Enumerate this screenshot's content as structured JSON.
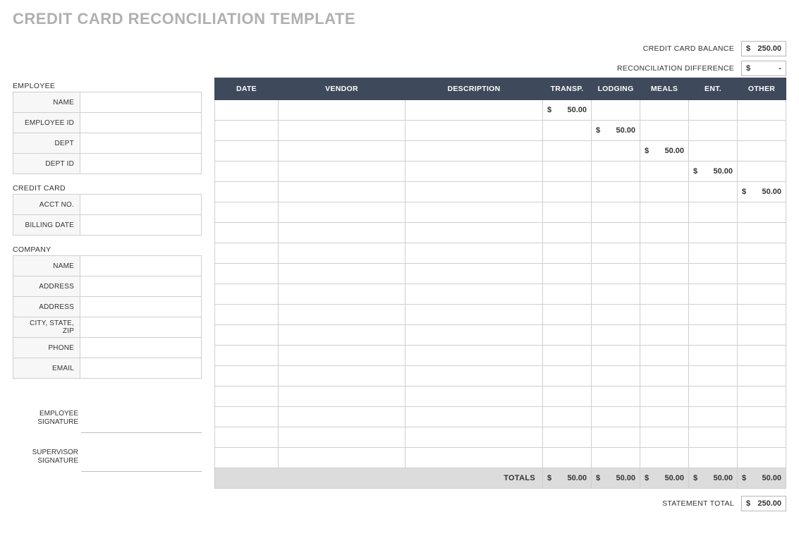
{
  "title": "CREDIT CARD RECONCILIATION TEMPLATE",
  "summary": {
    "balance_label": "CREDIT CARD BALANCE",
    "balance_currency": "$",
    "balance_value": "250.00",
    "diff_label": "RECONCILIATION DIFFERENCE",
    "diff_currency": "$",
    "diff_value": "-"
  },
  "side": {
    "employee": {
      "title": "EMPLOYEE",
      "rows": [
        {
          "label": "NAME",
          "value": ""
        },
        {
          "label": "EMPLOYEE ID",
          "value": ""
        },
        {
          "label": "DEPT",
          "value": ""
        },
        {
          "label": "DEPT ID",
          "value": ""
        }
      ]
    },
    "card": {
      "title": "CREDIT CARD",
      "rows": [
        {
          "label": "ACCT NO.",
          "value": ""
        },
        {
          "label": "BILLING DATE",
          "value": ""
        }
      ]
    },
    "company": {
      "title": "COMPANY",
      "rows": [
        {
          "label": "NAME",
          "value": ""
        },
        {
          "label": "ADDRESS",
          "value": ""
        },
        {
          "label": "ADDRESS",
          "value": ""
        },
        {
          "label": "CITY, STATE, ZIP",
          "value": ""
        },
        {
          "label": "PHONE",
          "value": ""
        },
        {
          "label": "EMAIL",
          "value": ""
        }
      ]
    },
    "signatures": {
      "employee1": "EMPLOYEE",
      "employee2": "SIGNATURE",
      "supervisor1": "SUPERVISOR",
      "supervisor2": "SIGNATURE"
    }
  },
  "grid": {
    "headers": [
      "DATE",
      "VENDOR",
      "DESCRIPTION",
      "TRANSP.",
      "LODGING",
      "MEALS",
      "ENT.",
      "OTHER"
    ],
    "currency": "$",
    "num_rows": 18,
    "cells": {
      "0": {
        "3": "50.00"
      },
      "1": {
        "4": "50.00"
      },
      "2": {
        "5": "50.00"
      },
      "3": {
        "6": "50.00"
      },
      "4": {
        "7": "50.00"
      }
    },
    "totals_label": "TOTALS",
    "totals": [
      "50.00",
      "50.00",
      "50.00",
      "50.00",
      "50.00"
    ]
  },
  "statement_total": {
    "label": "STATEMENT TOTAL",
    "currency": "$",
    "value": "250.00"
  }
}
